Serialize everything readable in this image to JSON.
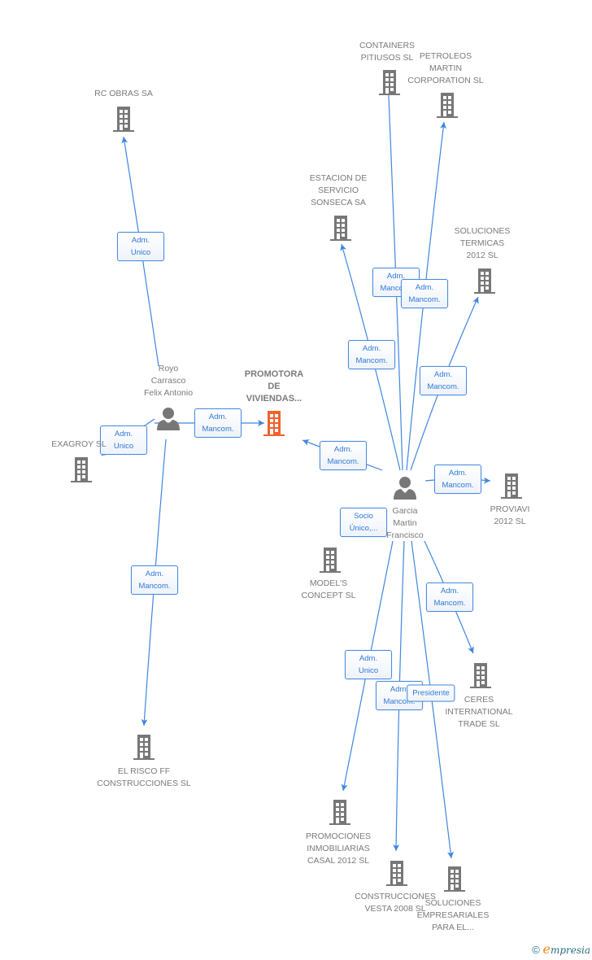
{
  "colors": {
    "edge": "#3f86e0",
    "building": "#777777",
    "main_building": "#f0622e",
    "person": "#777777"
  },
  "nodes": [
    {
      "id": "promotora",
      "type": "company",
      "main": true,
      "label": "PROMOTORA\nDE\nVIVIENDAS..."
    },
    {
      "id": "royo",
      "type": "person",
      "label": "Royo\nCarrasco\nFelix Antonio"
    },
    {
      "id": "garcia",
      "type": "person",
      "label": "Garcia\nMartin\nFrancisco"
    },
    {
      "id": "rc_obras",
      "type": "company",
      "label": "RC OBRAS SA"
    },
    {
      "id": "exagroy",
      "type": "company",
      "label": "EXAGROY SL"
    },
    {
      "id": "el_risco",
      "type": "company",
      "label": "EL RISCO FF\nCONSTRUCCIONES SL"
    },
    {
      "id": "containers",
      "type": "company",
      "label": "CONTAINERS\nPITIUSOS SL"
    },
    {
      "id": "petroleos",
      "type": "company",
      "label": "PETROLEOS\nMARTIN\nCORPORATION SL"
    },
    {
      "id": "estacion",
      "type": "company",
      "label": "ESTACION DE\nSERVICIO\nSONSECA SA"
    },
    {
      "id": "sol_termicas",
      "type": "company",
      "label": "SOLUCIONES\nTERMICAS\n2012 SL"
    },
    {
      "id": "proviavi",
      "type": "company",
      "label": "PROVIAVI\n2012 SL"
    },
    {
      "id": "models",
      "type": "company",
      "label": "MODEL'S\nCONCEPT  SL"
    },
    {
      "id": "ceres",
      "type": "company",
      "label": "CERES\nINTERNATIONAL\nTRADE SL"
    },
    {
      "id": "promociones",
      "type": "company",
      "label": "PROMOCIONES\nINMOBILIARIAS\nCASAL 2012 SL"
    },
    {
      "id": "vesta",
      "type": "company",
      "label": "CONSTRUCCIONES\nVESTA 2008 SL"
    },
    {
      "id": "sol_empresariales",
      "type": "company",
      "label": "SOLUCIONES\nEMPRESARIALES\nPARA EL..."
    }
  ],
  "edges": [
    {
      "from": "royo",
      "to": "rc_obras",
      "label": "Adm.\nUnico"
    },
    {
      "from": "royo",
      "to": "exagroy",
      "label": "Adm.\nUnico"
    },
    {
      "from": "royo",
      "to": "promotora",
      "label": "Adm.\nMancom."
    },
    {
      "from": "royo",
      "to": "el_risco",
      "label": "Adm.\nMancom."
    },
    {
      "from": "garcia",
      "to": "promotora",
      "label": "Adm.\nMancom."
    },
    {
      "from": "garcia",
      "to": "estacion",
      "label": "Adm.\nMancom."
    },
    {
      "from": "garcia",
      "to": "containers",
      "label": "Adm.\nMancom."
    },
    {
      "from": "garcia",
      "to": "petroleos",
      "label": "Adm.\nMancom."
    },
    {
      "from": "garcia",
      "to": "sol_termicas",
      "label": "Adm.\nMancom."
    },
    {
      "from": "garcia",
      "to": "proviavi",
      "label": "Adm.\nMancom."
    },
    {
      "from": "garcia",
      "to": "models",
      "label": "Socio\nÚnico,..."
    },
    {
      "from": "garcia",
      "to": "ceres",
      "label": "Adm.\nMancom."
    },
    {
      "from": "garcia",
      "to": "promociones",
      "label": "Adm.\nUnico"
    },
    {
      "from": "garcia",
      "to": "vesta",
      "label": "Adm.\nMancom."
    },
    {
      "from": "garcia",
      "to": "sol_empresariales",
      "label": "Presidente"
    }
  ],
  "brand": {
    "copyright": "©",
    "logo_initial": "e",
    "logo_rest": "mpresia"
  }
}
